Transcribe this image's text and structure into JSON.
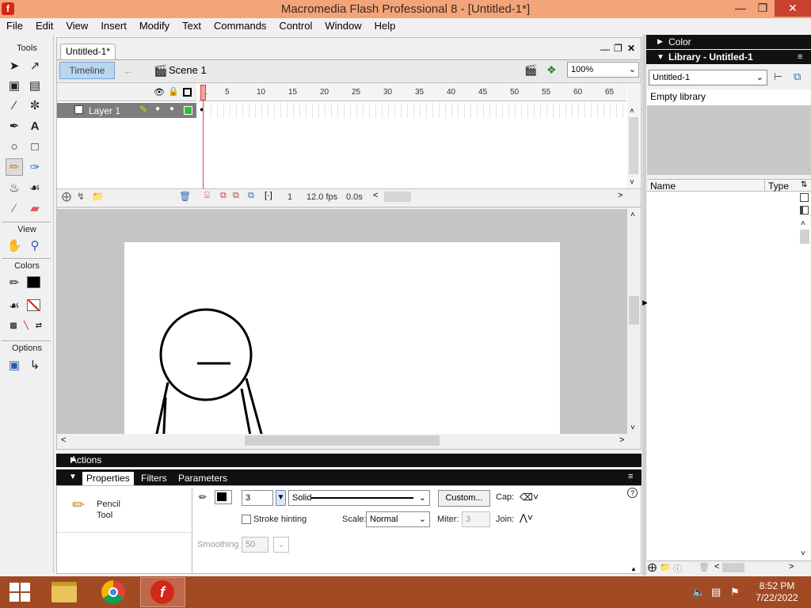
{
  "window": {
    "title": "Macromedia Flash Professional 8 - [Untitled-1*]",
    "app_icon_glyph": "f"
  },
  "menu": [
    "File",
    "Edit",
    "View",
    "Insert",
    "Modify",
    "Text",
    "Commands",
    "Control",
    "Window",
    "Help"
  ],
  "tools": {
    "header": "Tools",
    "view_label": "View",
    "colors_label": "Colors",
    "options_label": "Options",
    "selected": "pencil-tool"
  },
  "document": {
    "tab": "Untitled-1*",
    "timeline_button": "Timeline",
    "scene": "Scene 1",
    "zoom": "100%"
  },
  "timeline": {
    "layer_name": "Layer 1",
    "ruler": [
      "1",
      "5",
      "10",
      "15",
      "20",
      "25",
      "30",
      "35",
      "40",
      "45",
      "50",
      "55",
      "60",
      "65"
    ],
    "current_frame": "1",
    "frame_rate": "12.0 fps",
    "elapsed": "0.0s"
  },
  "panels": {
    "actions": "Actions",
    "color": "Color",
    "library_title": "Library - Untitled-1"
  },
  "properties": {
    "tabs": [
      "Properties",
      "Filters",
      "Parameters"
    ],
    "tool_name_line1": "Pencil",
    "tool_name_line2": "Tool",
    "stroke_color": "#000000",
    "stroke_height": "3",
    "stroke_style": "Solid",
    "custom_button": "Custom...",
    "cap_label": "Cap:",
    "stroke_hinting_label": "Stroke hinting",
    "stroke_hinting_checked": false,
    "scale_label": "Scale:",
    "scale_value": "Normal",
    "miter_label": "Miter:",
    "miter_value": "3",
    "join_label": "Join:",
    "smoothing_label": "Smoothing",
    "smoothing_value": "50"
  },
  "library": {
    "document_select": "Untitled-1",
    "empty_text": "Empty library",
    "col_name": "Name",
    "col_type": "Type"
  },
  "taskbar": {
    "time": "8:52 PM",
    "date": "7/22/2022"
  },
  "colors": {
    "titlebar": "#f3a47a",
    "taskbar": "#a24a24",
    "timeline_button": "#b9d6f2",
    "panel_header": "#111111",
    "close_button": "#c94230"
  }
}
